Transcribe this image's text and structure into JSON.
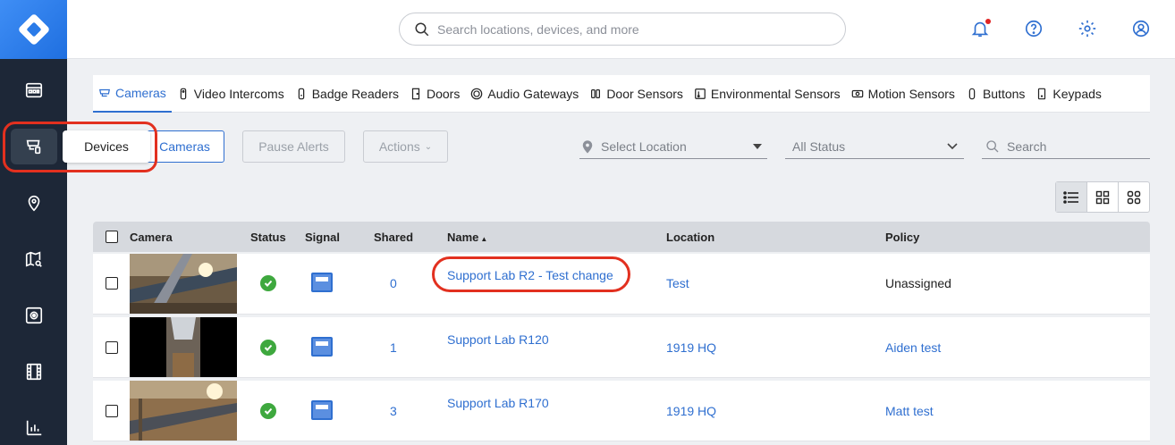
{
  "topbar": {
    "search_placeholder": "Search locations, devices, and more",
    "icons": [
      "bell-icon",
      "help-icon",
      "gear-icon",
      "user-icon"
    ]
  },
  "sidebar": {
    "icons": [
      "dashboard-icon",
      "devices-icon",
      "location-pin-icon",
      "map-search-icon",
      "camera-view-icon",
      "film-icon",
      "analytics-icon"
    ],
    "tooltip": "Devices"
  },
  "tabs": [
    {
      "label": "Cameras",
      "icon": "camera-icon",
      "active": true
    },
    {
      "label": "Video Intercoms",
      "icon": "intercom-icon"
    },
    {
      "label": "Badge Readers",
      "icon": "badge-reader-icon"
    },
    {
      "label": "Doors",
      "icon": "door-icon"
    },
    {
      "label": "Audio Gateways",
      "icon": "audio-gateway-icon"
    },
    {
      "label": "Door Sensors",
      "icon": "door-sensor-icon"
    },
    {
      "label": "Environmental Sensors",
      "icon": "environmental-sensor-icon"
    },
    {
      "label": "Motion Sensors",
      "icon": "motion-sensor-icon"
    },
    {
      "label": "Buttons",
      "icon": "button-device-icon"
    },
    {
      "label": "Keypads",
      "icon": "keypad-icon"
    }
  ],
  "controls": {
    "cameras_button": "Cameras",
    "pause_alerts": "Pause Alerts",
    "actions": "Actions",
    "select_location": "Select Location",
    "all_status": "All Status",
    "search_placeholder": "Search"
  },
  "table": {
    "headers": {
      "camera": "Camera",
      "status": "Status",
      "signal": "Signal",
      "shared": "Shared",
      "name": "Name",
      "location": "Location",
      "policy": "Policy"
    },
    "rows": [
      {
        "shared": "0",
        "name": "Support Lab R2 - Test change",
        "location": "Test",
        "policy": "Unassigned"
      },
      {
        "shared": "1",
        "name": "Support Lab R120",
        "location": "1919 HQ",
        "policy": "Aiden test"
      },
      {
        "shared": "3",
        "name": "Support Lab R170",
        "location": "1919 HQ",
        "policy": "Matt test"
      }
    ]
  },
  "colors": {
    "accent": "#2f6fd0",
    "sidebar": "#1d2737",
    "status_ok": "#3ea83e",
    "annotation": "#e2301f"
  }
}
